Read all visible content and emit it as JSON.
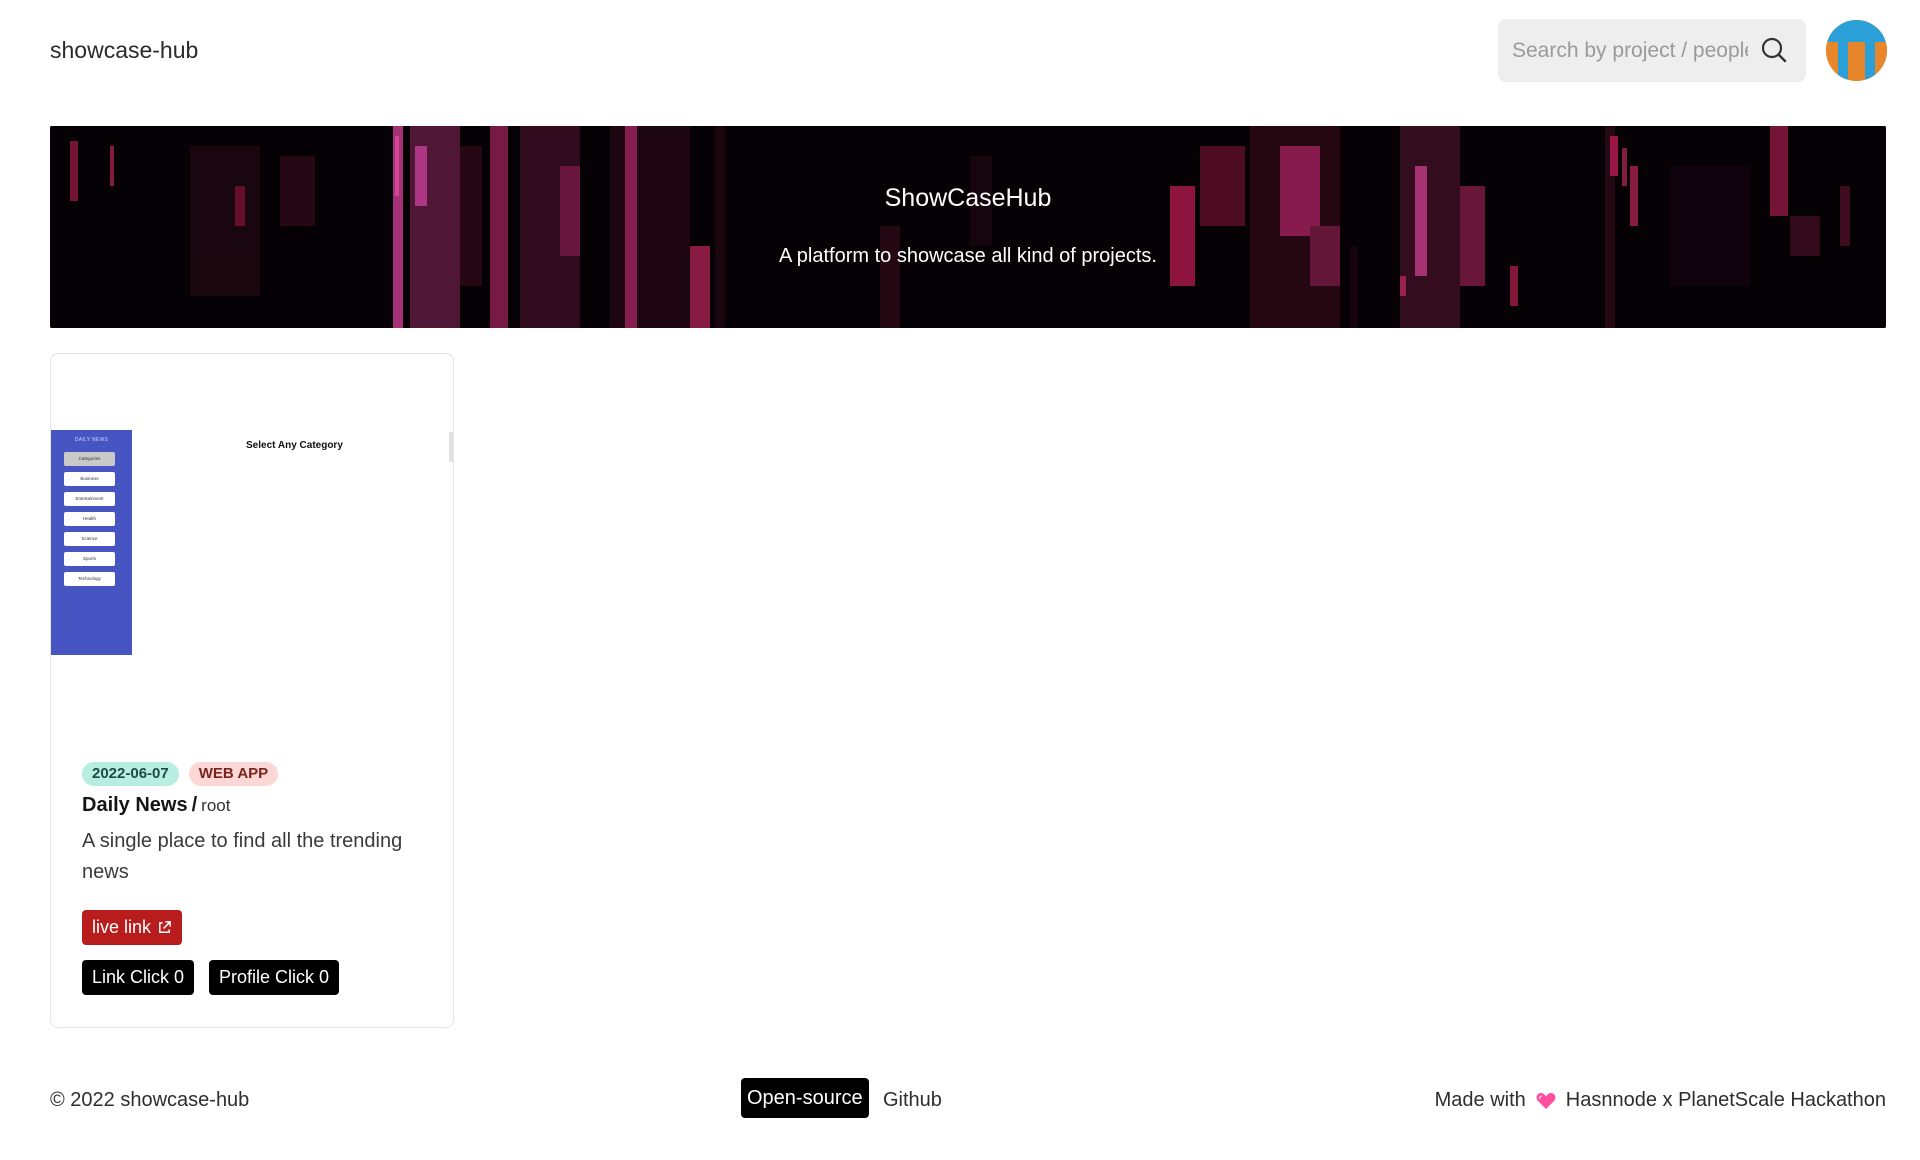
{
  "header": {
    "brand": "showcase-hub",
    "search_placeholder": "Search by project / people",
    "search_icon": "search-icon",
    "avatar_icon": "user-avatar"
  },
  "hero": {
    "title": "ShowCaseHub",
    "subtitle": "A platform to showcase all kind of projects."
  },
  "project": {
    "thumbnail": {
      "logo": "DAILY NEWS",
      "heading": "Select Any Category",
      "categories": [
        "Categories",
        "Business",
        "Entertainment",
        "Health",
        "Science",
        "Sports",
        "Technology"
      ]
    },
    "date": "2022-06-07",
    "type": "WEB APP",
    "name": "Daily News",
    "separator": "/",
    "owner": "root",
    "description": "A single place to find all the trending news",
    "live_link_label": "live link",
    "link_click": "Link Click 0",
    "profile_click": "Profile Click 0"
  },
  "footer": {
    "copyright": "© 2022 showcase-hub",
    "opensource": "Open-source",
    "github": "Github",
    "made_with": "Made with",
    "made_by": "Hasnnode x PlanetScale Hackathon"
  },
  "colors": {
    "live_link": "#b91c1c",
    "date_tag": "#b8eee2",
    "type_tag": "#fbd8d5",
    "thumb_sidebar": "#4655c2",
    "heart": "#ff4fa0"
  }
}
